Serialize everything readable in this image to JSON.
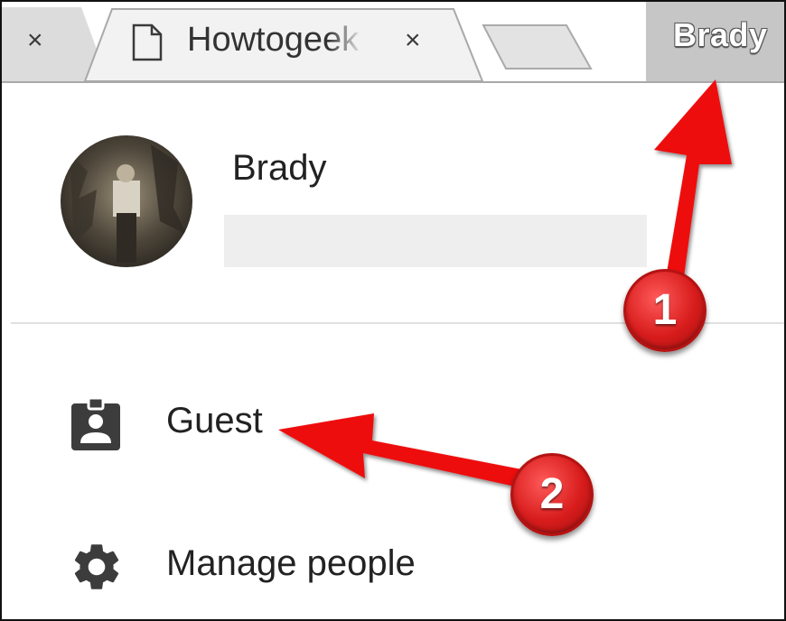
{
  "tabs": {
    "prev_close_glyph": "×",
    "active_title": "Howtogeek",
    "active_close_glyph": "×",
    "active_icon": "document-icon"
  },
  "profile_button": {
    "label": "Brady"
  },
  "profile": {
    "name": "Brady",
    "email": ""
  },
  "menu": {
    "items": [
      {
        "label": "Guest",
        "icon": "guest-badge-icon"
      },
      {
        "label": "Manage people",
        "icon": "gear-icon"
      }
    ]
  },
  "annotations": {
    "step1": "1",
    "step2": "2",
    "arrow_color": "#ee1111"
  },
  "colors": {
    "icon": "#3c3c3c",
    "text": "#222222"
  }
}
